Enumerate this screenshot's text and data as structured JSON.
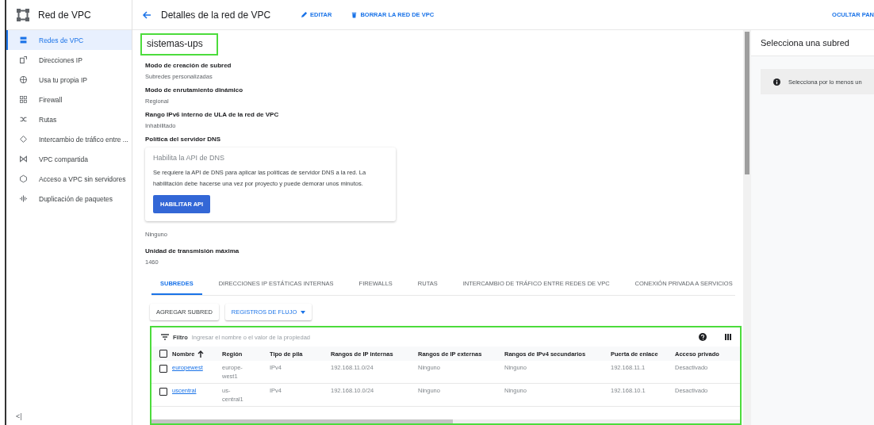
{
  "sidebar": {
    "title": "Red de VPC",
    "items": [
      {
        "label": "Redes de VPC",
        "selected": true
      },
      {
        "label": "Direcciones IP",
        "selected": false
      },
      {
        "label": "Usa tu propia IP",
        "selected": false
      },
      {
        "label": "Firewall",
        "selected": false
      },
      {
        "label": "Rutas",
        "selected": false
      },
      {
        "label": "Intercambio de tráfico entre ...",
        "selected": false
      },
      {
        "label": "VPC compartida",
        "selected": false
      },
      {
        "label": "Acceso a VPC sin servidores",
        "selected": false
      },
      {
        "label": "Duplicación de paquetes",
        "selected": false
      }
    ],
    "collapse": "<|"
  },
  "header": {
    "title": "Detalles de la red de VPC",
    "actions": [
      "EDITAR",
      "BORRAR LA RED DE VPC"
    ],
    "hide_panel": "OCULTAR PAN"
  },
  "network": {
    "name": "sistemas-ups",
    "fields": [
      {
        "label": "Modo de creación de subred",
        "value": "Subredes personalizadas"
      },
      {
        "label": "Modo de enrutamiento dinámico",
        "value": "Regional"
      },
      {
        "label": "Rango IPv6 interno de ULA de la red de VPC",
        "value": "Inhabilitado"
      }
    ],
    "dns_label": "Política del servidor DNS",
    "dns_card": {
      "title": "Habilita la API de DNS",
      "text": "Se requiere la API de DNS para aplicar las políticas de servidor DNS a la red. La habilitación debe hacerse una vez por proyecto y puede demorar unos minutos.",
      "button": "HABILITAR API"
    },
    "dns_value": "Ninguno",
    "mtu": {
      "label": "Unidad de transmisión máxima",
      "value": "1460"
    }
  },
  "tabs": [
    {
      "label": "SUBREDES",
      "selected": true
    },
    {
      "label": "DIRECCIONES IP ESTÁTICAS INTERNAS",
      "selected": false
    },
    {
      "label": "FIREWALLS",
      "selected": false
    },
    {
      "label": "RUTAS",
      "selected": false
    },
    {
      "label": "INTERCAMBIO DE TRÁFICO ENTRE REDES DE VPC",
      "selected": false
    },
    {
      "label": "CONEXIÓN PRIVADA A SERVICIOS",
      "selected": false
    }
  ],
  "toolbar": {
    "add": "AGREGAR SUBRED",
    "flow_logs": "REGISTROS DE FLUJO"
  },
  "table": {
    "all_checked": false,
    "filter_label": "Filtro",
    "filter_placeholder": "Ingresar el nombre o el valor de la propiedad",
    "columns": [
      "Nombre",
      "Región",
      "Tipo de pila",
      "Rangos de IP internas",
      "Rangos de IP externas",
      "Rangos de IPv4 secundarios",
      "Puerta de enlace",
      "Acceso privado"
    ],
    "rows": [
      {
        "checked": false,
        "cells": [
          "europewest",
          "europe-west1",
          "IPv4",
          "192.168.11.0/24",
          "Ninguno",
          "Ninguno",
          "192.168.11.1",
          "Desactivado"
        ]
      },
      {
        "checked": false,
        "cells": [
          "uscentral",
          "us-central1",
          "IPv4",
          "192.168.10.0/24",
          "Ninguno",
          "Ninguno",
          "192.168.10.1",
          "Desactivado"
        ]
      }
    ]
  },
  "panel": {
    "title": "Selecciona una subred",
    "info": "Selecciona por lo menos un"
  }
}
